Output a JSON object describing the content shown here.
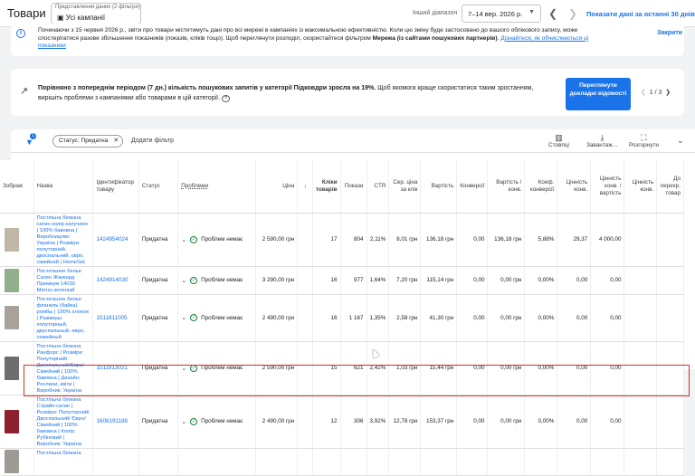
{
  "header": {
    "title": "Товари",
    "view_caption": "Представлення даних (2 фільтри)",
    "view_value": "Усі кампанії",
    "range_label": "Інший діапазон",
    "date_range": "7–14 вер. 2026 р.",
    "show_last_30": "Показати дані за останні 30 днів"
  },
  "notice": {
    "text": "Починаючи з 15 червня 2026 р., звіти про товари міститимуть дані про всі мережі в кампаніях із максимальною ефективністю. Коли цю зміну буде застосовано до вашого облікового запису, може спостерігатися разове збільшення показників (показів, кліків тощо). Щоб переглянути розподіл, скористайтеся фільтром ",
    "bold_text": "Мережа (із сайтами пошукових партнерів)",
    "after_bold": ". ",
    "link": "Дізнайтеся, як обчислюються ці показники",
    "close": "Закрити"
  },
  "insight": {
    "bold_text": "Порівняно з попереднім періодом (7 дн.) кількість пошукових запитів у категорії Підковдри зросла на 19%.",
    "text": " Щоб якомога краще скористатися таким зростанням, вирішіть проблеми з кампаніями або товарами в цій категорії.",
    "cta": "Переглянути докладні відомості",
    "pager": "1 / 3"
  },
  "toolbar": {
    "filter_count": "1",
    "chip": "Статус: Придатна",
    "add_filter": "Додати фільтр",
    "columns": "Стовпці",
    "download": "Завантаж…",
    "expand": "Розгорнути"
  },
  "columns": [
    "Зображ",
    "Назва",
    "Ідентифікатор товару",
    "Статус",
    "Проблеми",
    "Ціна",
    "",
    "Кліки товарів",
    "Покази",
    "CTR",
    "Сер. ціна за клік",
    "Вартість",
    "Конверсії",
    "Вартість / конв.",
    "Коеф. конверсії",
    "Цінність конв.",
    "Цінність конв. / вартість",
    "Цінність конв.",
    "До перехр. товар"
  ],
  "rows": [
    {
      "thumb_color": "#c2b7a6",
      "name": "Постільна білизна сатин колір капучино | 100% бавовна | Виробництво: Україна | Розміри: полуторний, двоспальний, євро, сімейний | HomeSet",
      "id": "1424954024",
      "status": "Придатна",
      "issues": "Проблем немає",
      "price": "2 590,00 грн",
      "clicks": "17",
      "impr": "804",
      "ctr": "2,11%",
      "cpc": "8,01 грн",
      "cost": "136,18 грн",
      "conv": "0,00",
      "cost_conv": "136,18 грн",
      "conv_rate": "5,88%",
      "conv_val": "29,37",
      "val_cost": "4 000,00"
    },
    {
      "thumb_color": "#8fb08a",
      "name": "Постельное белье Сатин Жаккард Премиум 14030 Мятно-зеленый",
      "id": "1424914030",
      "status": "Придатна",
      "issues": "Проблем немає",
      "price": "3 290,00 грн",
      "clicks": "16",
      "impr": "977",
      "ctr": "1,64%",
      "cpc": "7,20 грн",
      "cost": "115,14 грн",
      "conv": "0,00",
      "cost_conv": "0,00 грн",
      "conv_rate": "0,00%",
      "conv_val": "0,00",
      "val_cost": "0,00"
    },
    {
      "thumb_color": "#a9a29a",
      "name": "Постельное белье фланель (байка) ромбы | 100% хлопок | Размеры: полуторный, двуспальный, евро, семейный",
      "id": "1511811005",
      "status": "Придатна",
      "issues": "Проблем немає",
      "price": "2 490,00 грн",
      "clicks": "16",
      "impr": "1 167",
      "ctr": "1,35%",
      "cpc": "2,58 грн",
      "cost": "41,30 грн",
      "conv": "0,00",
      "cost_conv": "0,00 грн",
      "conv_rate": "0,00%",
      "conv_val": "0,00",
      "val_cost": "0,00"
    },
    {
      "thumb_color": "#6e6e70",
      "name": "Постільна білизна Ранфорс | Розміри: Полуторний/ Двоспальний/Євро/ Сімейний | 100% бавовна | Дизайн: Рослини, квіти | Виробник: Україна",
      "id": "1511813021",
      "status": "Придатна",
      "issues": "Проблем немає",
      "price": "2 590,00 грн",
      "clicks": "15",
      "impr": "621",
      "ctr": "2,42%",
      "cpc": "1,03 грн",
      "cost": "15,44 грн",
      "conv": "0,00",
      "cost_conv": "0,00 грн",
      "conv_rate": "0,00%",
      "conv_val": "0,00",
      "val_cost": "0,00"
    },
    {
      "thumb_color": "#8e1f2e",
      "name": "Постільна білизна Страйп-сатин | Розміри: Полуторний/Двоспальний/ Євро/Сімейний | 100% бавовна | Колір: Рубіновий | Виробник: Україна",
      "id": "1606191188",
      "status": "Придатна",
      "issues": "Проблем немає",
      "price": "2 490,00 грн",
      "clicks": "12",
      "impr": "306",
      "ctr": "3,92%",
      "cpc": "12,78 грн",
      "cost": "153,37 грн",
      "conv": "0,00",
      "cost_conv": "0,00 грн",
      "conv_rate": "0,00%",
      "conv_val": "0,00",
      "val_cost": "0,00"
    }
  ],
  "partial_row": {
    "thumb_color": "#9e9a94",
    "name": "Постільна білизна"
  }
}
